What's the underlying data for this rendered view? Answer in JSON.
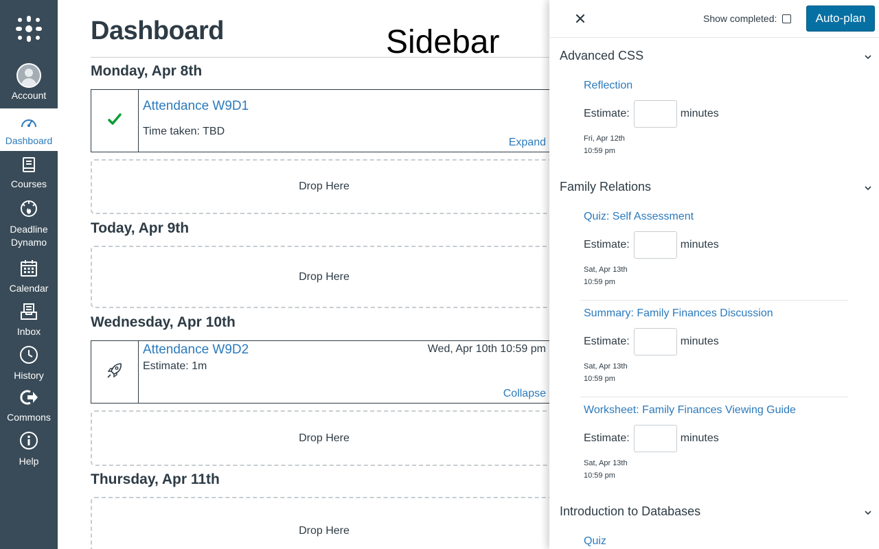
{
  "nav": {
    "items": [
      {
        "label": "Account",
        "icon": "account-avatar-icon"
      },
      {
        "label": "Dashboard",
        "icon": "dashboard-gauge-icon"
      },
      {
        "label": "Courses",
        "icon": "courses-book-icon"
      },
      {
        "label": "Deadline Dynamo",
        "icon": "deadline-dynamo-icon"
      },
      {
        "label": "Calendar",
        "icon": "calendar-icon"
      },
      {
        "label": "Inbox",
        "icon": "inbox-icon"
      },
      {
        "label": "History",
        "icon": "history-clock-icon"
      },
      {
        "label": "Commons",
        "icon": "commons-arrow-icon"
      },
      {
        "label": "Help",
        "icon": "help-info-icon"
      }
    ],
    "active": "Dashboard",
    "colors": {
      "background": "#394b58",
      "active_text": "#2b7abc"
    }
  },
  "main": {
    "title": "Dashboard",
    "overlay_caption": "Sidebar",
    "days": [
      {
        "heading": "Monday, Apr 8th",
        "card": {
          "title": "Attendance W9D1",
          "subtitle": "Time taken: TBD",
          "toggle": "Expand",
          "icon": "checkmark-icon",
          "status": "completed"
        },
        "drop": "Drop Here"
      },
      {
        "heading": "Today, Apr 9th",
        "drop": "Drop Here"
      },
      {
        "heading": "Wednesday, Apr 10th",
        "card": {
          "title": "Attendance W9D2",
          "subtitle": "Estimate: 1m",
          "due": "Wed, Apr 10th 10:59 pm",
          "toggle": "Collapse",
          "icon": "rocket-icon"
        },
        "drop": "Drop Here"
      },
      {
        "heading": "Thursday, Apr 11th",
        "drop": "Drop Here"
      }
    ]
  },
  "sidebar": {
    "close_icon": "close-icon",
    "show_completed_label": "Show completed:",
    "show_completed_checked": false,
    "autoplan_label": "Auto-plan",
    "accent": "#0770a3",
    "estimate_label": "Estimate:",
    "minutes_label": "minutes",
    "courses": [
      {
        "name": "Advanced CSS",
        "tasks": [
          {
            "title": "Reflection",
            "due_date": "Fri, Apr 12th",
            "due_time": "10:59 pm"
          }
        ]
      },
      {
        "name": "Family Relations",
        "tasks": [
          {
            "title": "Quiz: Self Assessment",
            "due_date": "Sat, Apr 13th",
            "due_time": "10:59 pm"
          },
          {
            "title": "Summary: Family Finances Discussion",
            "due_date": "Sat, Apr 13th",
            "due_time": "10:59 pm"
          },
          {
            "title": "Worksheet: Family Finances Viewing Guide",
            "due_date": "Sat, Apr 13th",
            "due_time": "10:59 pm"
          }
        ]
      },
      {
        "name": "Introduction to Databases",
        "tasks": [
          {
            "title": "Quiz"
          }
        ]
      }
    ]
  }
}
